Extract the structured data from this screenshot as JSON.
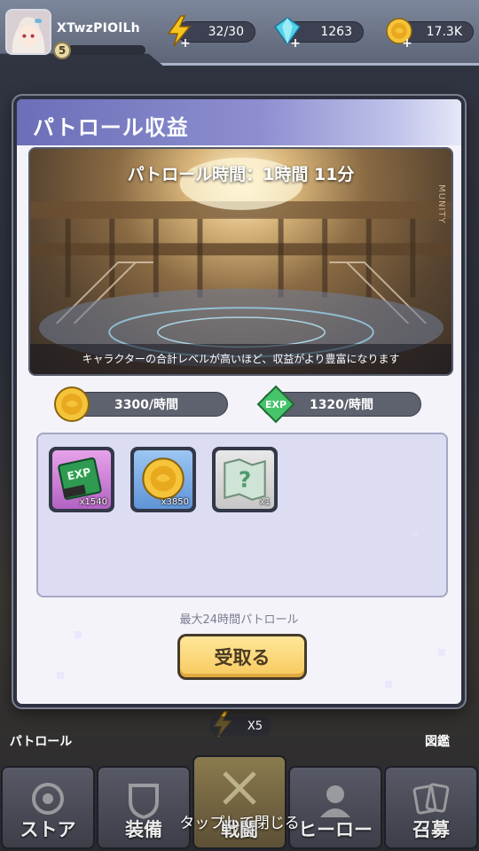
{
  "player": {
    "name": "XTwzPIOlLh",
    "level": "5"
  },
  "resources": {
    "stamina": "32/30",
    "gems": "1263",
    "gold": "17.3K"
  },
  "modal": {
    "title": "パトロール収益",
    "patrol_time": "パトロール時間：1時間 11分",
    "caption": "キャラクターの合計レベルが高いほど、収益がより豊富になります",
    "gold_rate": "3300/時間",
    "exp_rate": "1320/時間",
    "exp_icon_label": "EXP",
    "items": [
      {
        "name": "exp-book",
        "count": "x1540",
        "label": "EXP"
      },
      {
        "name": "gold-coin",
        "count": "x3850"
      },
      {
        "name": "mystery-map",
        "count": "x1"
      }
    ],
    "max_note": "最大24時間パトロール",
    "claim_label": "受取る"
  },
  "background": {
    "patrol_label": "パトロール",
    "zukan_label": "図鑑",
    "speed_label": "X5",
    "banner_sign": "MUNITY"
  },
  "nav": {
    "items": [
      {
        "label": "ストア"
      },
      {
        "label": "装備"
      },
      {
        "label": "戦闘"
      },
      {
        "label": "ヒーロー"
      },
      {
        "label": "召募"
      }
    ]
  },
  "tap_to_close": "タップして閉じる",
  "colors": {
    "header_gradient_start": "#6c6fb8",
    "claim_button": "#f7c95d",
    "reward_box_bg": "#dcdcf3"
  }
}
